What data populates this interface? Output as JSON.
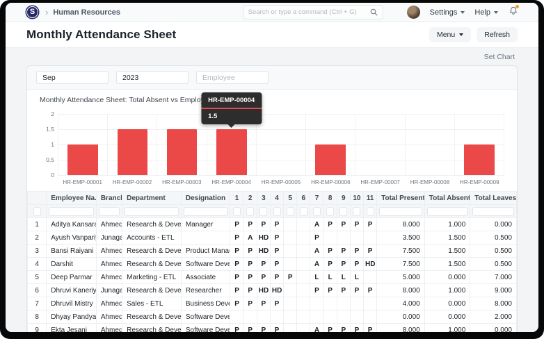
{
  "colors": {
    "bar_red": "#eb4848",
    "tooltip_divider_red": "#e04b4b",
    "notification_dot_orange": "#f79a28",
    "logo_navy": "#272768"
  },
  "navbar": {
    "logo_letter": "S",
    "breadcrumb_chevron": "›",
    "breadcrumb": "Human Resources",
    "search_placeholder": "Search or type a command (Ctrl + G)",
    "settings_label": "Settings",
    "help_label": "Help"
  },
  "page_header": {
    "title": "Monthly Attendance Sheet",
    "menu_label": "Menu",
    "refresh_label": "Refresh"
  },
  "toolbar": {
    "set_chart_label": "Set Chart"
  },
  "filters": {
    "month_value": "Sep",
    "year_value": "2023",
    "employee_placeholder": "Employee"
  },
  "chart_data": {
    "type": "bar",
    "title": "Monthly Attendance Sheet: Total Absent vs Employee",
    "categories": [
      "HR-EMP-00001",
      "HR-EMP-00002",
      "HR-EMP-00003",
      "HR-EMP-00004",
      "HR-EMP-00005",
      "HR-EMP-00006",
      "HR-EMP-00007",
      "HR-EMP-00008",
      "HR-EMP-00009"
    ],
    "values": [
      1,
      1.5,
      1.5,
      1.5,
      0,
      1,
      0,
      0,
      1
    ],
    "y_ticks": [
      "2",
      "1.5",
      "1",
      "0.5",
      "0"
    ],
    "ylim": [
      0,
      2
    ],
    "grid": true,
    "legend": "none",
    "tooltip": {
      "label": "HR-EMP-00004",
      "value": "1.5",
      "index": 3
    }
  },
  "table": {
    "row_number_header": "",
    "text_columns": [
      "Employee Na...",
      "Branch",
      "Department",
      "Designation"
    ],
    "day_columns": [
      "1",
      "2",
      "3",
      "4",
      "5",
      "6",
      "7",
      "8",
      "9",
      "10",
      "11"
    ],
    "summary_columns": [
      "Total Present",
      "Total Absent",
      "Total Leaves"
    ],
    "rows": [
      {
        "num": "1",
        "name": "Aditya Kansara",
        "branch": "Ahmeda...",
        "department": "Research & Develop...",
        "designation": "Manager",
        "days": [
          "P",
          "P",
          "P",
          "P",
          "",
          "",
          "A",
          "P",
          "P",
          "P",
          "P"
        ],
        "total_present": "8.000",
        "total_absent": "1.000",
        "total_leaves": "0.000"
      },
      {
        "num": "2",
        "name": "Ayush Vanpariya",
        "branch": "Junagadh",
        "department": "Accounts - ETL",
        "designation": "",
        "days": [
          "P",
          "A",
          "HD",
          "P",
          "",
          "",
          "P",
          "",
          "",
          "",
          ""
        ],
        "total_present": "3.500",
        "total_absent": "1.500",
        "total_leaves": "0.500"
      },
      {
        "num": "3",
        "name": "Bansi Raiyani",
        "branch": "Ahmeda...",
        "department": "Research & Develop...",
        "designation": "Product Manager",
        "days": [
          "P",
          "P",
          "HD",
          "P",
          "",
          "",
          "A",
          "P",
          "P",
          "P",
          "P"
        ],
        "total_present": "7.500",
        "total_absent": "1.500",
        "total_leaves": "0.500"
      },
      {
        "num": "4",
        "name": "Darshit",
        "branch": "Ahmeda...",
        "department": "Research & Develop...",
        "designation": "Software Develo...",
        "days": [
          "P",
          "P",
          "P",
          "P",
          "",
          "",
          "A",
          "P",
          "P",
          "P",
          "HD"
        ],
        "total_present": "7.500",
        "total_absent": "1.500",
        "total_leaves": "0.500"
      },
      {
        "num": "5",
        "name": "Deep Parmar",
        "branch": "Ahmeda...",
        "department": "Marketing - ETL",
        "designation": "Associate",
        "days": [
          "P",
          "P",
          "P",
          "P",
          "P",
          "",
          "L",
          "L",
          "L",
          "L",
          ""
        ],
        "total_present": "5.000",
        "total_absent": "0.000",
        "total_leaves": "7.000"
      },
      {
        "num": "6",
        "name": "Dhruvi Kaneriya",
        "branch": "Junagadh",
        "department": "Research & Develop...",
        "designation": "Researcher",
        "days": [
          "P",
          "P",
          "HD",
          "HD",
          "",
          "",
          "P",
          "P",
          "P",
          "P",
          "P"
        ],
        "total_present": "8.000",
        "total_absent": "1.000",
        "total_leaves": "9.000"
      },
      {
        "num": "7",
        "name": "Dhruvil Mistry",
        "branch": "Ahmeda...",
        "department": "Sales - ETL",
        "designation": "Business Develo...",
        "days": [
          "P",
          "P",
          "P",
          "P",
          "",
          "",
          "",
          "",
          "",
          "",
          ""
        ],
        "total_present": "4.000",
        "total_absent": "0.000",
        "total_leaves": "8.000"
      },
      {
        "num": "8",
        "name": "Dhyay Pandya",
        "branch": "Ahmeda...",
        "department": "Research & Develop...",
        "designation": "Software Develo...",
        "days": [
          "",
          "",
          "",
          "",
          "",
          "",
          "",
          "",
          "",
          "",
          ""
        ],
        "total_present": "0.000",
        "total_absent": "0.000",
        "total_leaves": "2.000"
      },
      {
        "num": "9",
        "name": "Ekta Jesani",
        "branch": "Ahmeda...",
        "department": "Research & Develop...",
        "designation": "Software Develo...",
        "days": [
          "P",
          "P",
          "P",
          "P",
          "",
          "",
          "A",
          "P",
          "P",
          "P",
          "P"
        ],
        "total_present": "8.000",
        "total_absent": "1.000",
        "total_leaves": "0.000"
      }
    ]
  }
}
